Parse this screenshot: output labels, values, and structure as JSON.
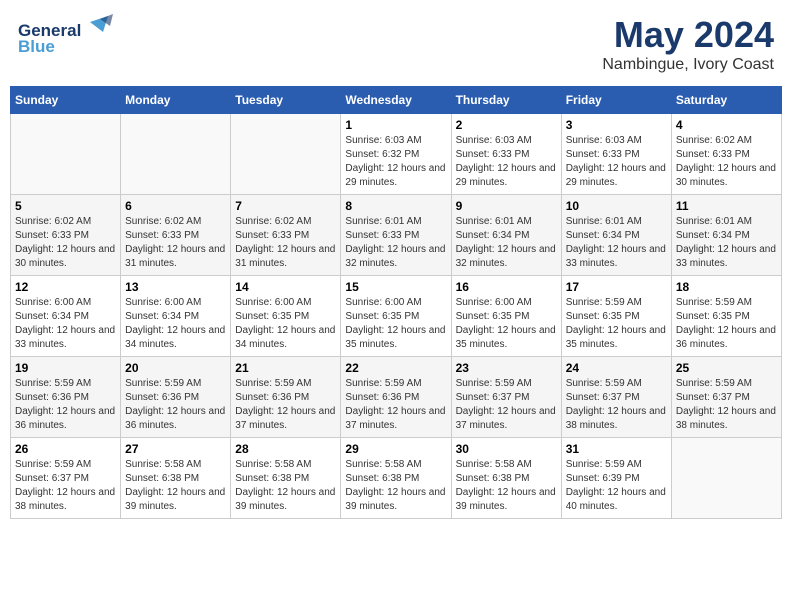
{
  "logo": {
    "general": "General",
    "blue": "Blue"
  },
  "title": "May 2024",
  "subtitle": "Nambingue, Ivory Coast",
  "days_of_week": [
    "Sunday",
    "Monday",
    "Tuesday",
    "Wednesday",
    "Thursday",
    "Friday",
    "Saturday"
  ],
  "weeks": [
    [
      {
        "day": "",
        "sunrise": "",
        "sunset": "",
        "daylight": ""
      },
      {
        "day": "",
        "sunrise": "",
        "sunset": "",
        "daylight": ""
      },
      {
        "day": "",
        "sunrise": "",
        "sunset": "",
        "daylight": ""
      },
      {
        "day": "1",
        "sunrise": "Sunrise: 6:03 AM",
        "sunset": "Sunset: 6:32 PM",
        "daylight": "Daylight: 12 hours and 29 minutes."
      },
      {
        "day": "2",
        "sunrise": "Sunrise: 6:03 AM",
        "sunset": "Sunset: 6:33 PM",
        "daylight": "Daylight: 12 hours and 29 minutes."
      },
      {
        "day": "3",
        "sunrise": "Sunrise: 6:03 AM",
        "sunset": "Sunset: 6:33 PM",
        "daylight": "Daylight: 12 hours and 29 minutes."
      },
      {
        "day": "4",
        "sunrise": "Sunrise: 6:02 AM",
        "sunset": "Sunset: 6:33 PM",
        "daylight": "Daylight: 12 hours and 30 minutes."
      }
    ],
    [
      {
        "day": "5",
        "sunrise": "Sunrise: 6:02 AM",
        "sunset": "Sunset: 6:33 PM",
        "daylight": "Daylight: 12 hours and 30 minutes."
      },
      {
        "day": "6",
        "sunrise": "Sunrise: 6:02 AM",
        "sunset": "Sunset: 6:33 PM",
        "daylight": "Daylight: 12 hours and 31 minutes."
      },
      {
        "day": "7",
        "sunrise": "Sunrise: 6:02 AM",
        "sunset": "Sunset: 6:33 PM",
        "daylight": "Daylight: 12 hours and 31 minutes."
      },
      {
        "day": "8",
        "sunrise": "Sunrise: 6:01 AM",
        "sunset": "Sunset: 6:33 PM",
        "daylight": "Daylight: 12 hours and 32 minutes."
      },
      {
        "day": "9",
        "sunrise": "Sunrise: 6:01 AM",
        "sunset": "Sunset: 6:34 PM",
        "daylight": "Daylight: 12 hours and 32 minutes."
      },
      {
        "day": "10",
        "sunrise": "Sunrise: 6:01 AM",
        "sunset": "Sunset: 6:34 PM",
        "daylight": "Daylight: 12 hours and 33 minutes."
      },
      {
        "day": "11",
        "sunrise": "Sunrise: 6:01 AM",
        "sunset": "Sunset: 6:34 PM",
        "daylight": "Daylight: 12 hours and 33 minutes."
      }
    ],
    [
      {
        "day": "12",
        "sunrise": "Sunrise: 6:00 AM",
        "sunset": "Sunset: 6:34 PM",
        "daylight": "Daylight: 12 hours and 33 minutes."
      },
      {
        "day": "13",
        "sunrise": "Sunrise: 6:00 AM",
        "sunset": "Sunset: 6:34 PM",
        "daylight": "Daylight: 12 hours and 34 minutes."
      },
      {
        "day": "14",
        "sunrise": "Sunrise: 6:00 AM",
        "sunset": "Sunset: 6:35 PM",
        "daylight": "Daylight: 12 hours and 34 minutes."
      },
      {
        "day": "15",
        "sunrise": "Sunrise: 6:00 AM",
        "sunset": "Sunset: 6:35 PM",
        "daylight": "Daylight: 12 hours and 35 minutes."
      },
      {
        "day": "16",
        "sunrise": "Sunrise: 6:00 AM",
        "sunset": "Sunset: 6:35 PM",
        "daylight": "Daylight: 12 hours and 35 minutes."
      },
      {
        "day": "17",
        "sunrise": "Sunrise: 5:59 AM",
        "sunset": "Sunset: 6:35 PM",
        "daylight": "Daylight: 12 hours and 35 minutes."
      },
      {
        "day": "18",
        "sunrise": "Sunrise: 5:59 AM",
        "sunset": "Sunset: 6:35 PM",
        "daylight": "Daylight: 12 hours and 36 minutes."
      }
    ],
    [
      {
        "day": "19",
        "sunrise": "Sunrise: 5:59 AM",
        "sunset": "Sunset: 6:36 PM",
        "daylight": "Daylight: 12 hours and 36 minutes."
      },
      {
        "day": "20",
        "sunrise": "Sunrise: 5:59 AM",
        "sunset": "Sunset: 6:36 PM",
        "daylight": "Daylight: 12 hours and 36 minutes."
      },
      {
        "day": "21",
        "sunrise": "Sunrise: 5:59 AM",
        "sunset": "Sunset: 6:36 PM",
        "daylight": "Daylight: 12 hours and 37 minutes."
      },
      {
        "day": "22",
        "sunrise": "Sunrise: 5:59 AM",
        "sunset": "Sunset: 6:36 PM",
        "daylight": "Daylight: 12 hours and 37 minutes."
      },
      {
        "day": "23",
        "sunrise": "Sunrise: 5:59 AM",
        "sunset": "Sunset: 6:37 PM",
        "daylight": "Daylight: 12 hours and 37 minutes."
      },
      {
        "day": "24",
        "sunrise": "Sunrise: 5:59 AM",
        "sunset": "Sunset: 6:37 PM",
        "daylight": "Daylight: 12 hours and 38 minutes."
      },
      {
        "day": "25",
        "sunrise": "Sunrise: 5:59 AM",
        "sunset": "Sunset: 6:37 PM",
        "daylight": "Daylight: 12 hours and 38 minutes."
      }
    ],
    [
      {
        "day": "26",
        "sunrise": "Sunrise: 5:59 AM",
        "sunset": "Sunset: 6:37 PM",
        "daylight": "Daylight: 12 hours and 38 minutes."
      },
      {
        "day": "27",
        "sunrise": "Sunrise: 5:58 AM",
        "sunset": "Sunset: 6:38 PM",
        "daylight": "Daylight: 12 hours and 39 minutes."
      },
      {
        "day": "28",
        "sunrise": "Sunrise: 5:58 AM",
        "sunset": "Sunset: 6:38 PM",
        "daylight": "Daylight: 12 hours and 39 minutes."
      },
      {
        "day": "29",
        "sunrise": "Sunrise: 5:58 AM",
        "sunset": "Sunset: 6:38 PM",
        "daylight": "Daylight: 12 hours and 39 minutes."
      },
      {
        "day": "30",
        "sunrise": "Sunrise: 5:58 AM",
        "sunset": "Sunset: 6:38 PM",
        "daylight": "Daylight: 12 hours and 39 minutes."
      },
      {
        "day": "31",
        "sunrise": "Sunrise: 5:59 AM",
        "sunset": "Sunset: 6:39 PM",
        "daylight": "Daylight: 12 hours and 40 minutes."
      },
      {
        "day": "",
        "sunrise": "",
        "sunset": "",
        "daylight": ""
      }
    ]
  ]
}
